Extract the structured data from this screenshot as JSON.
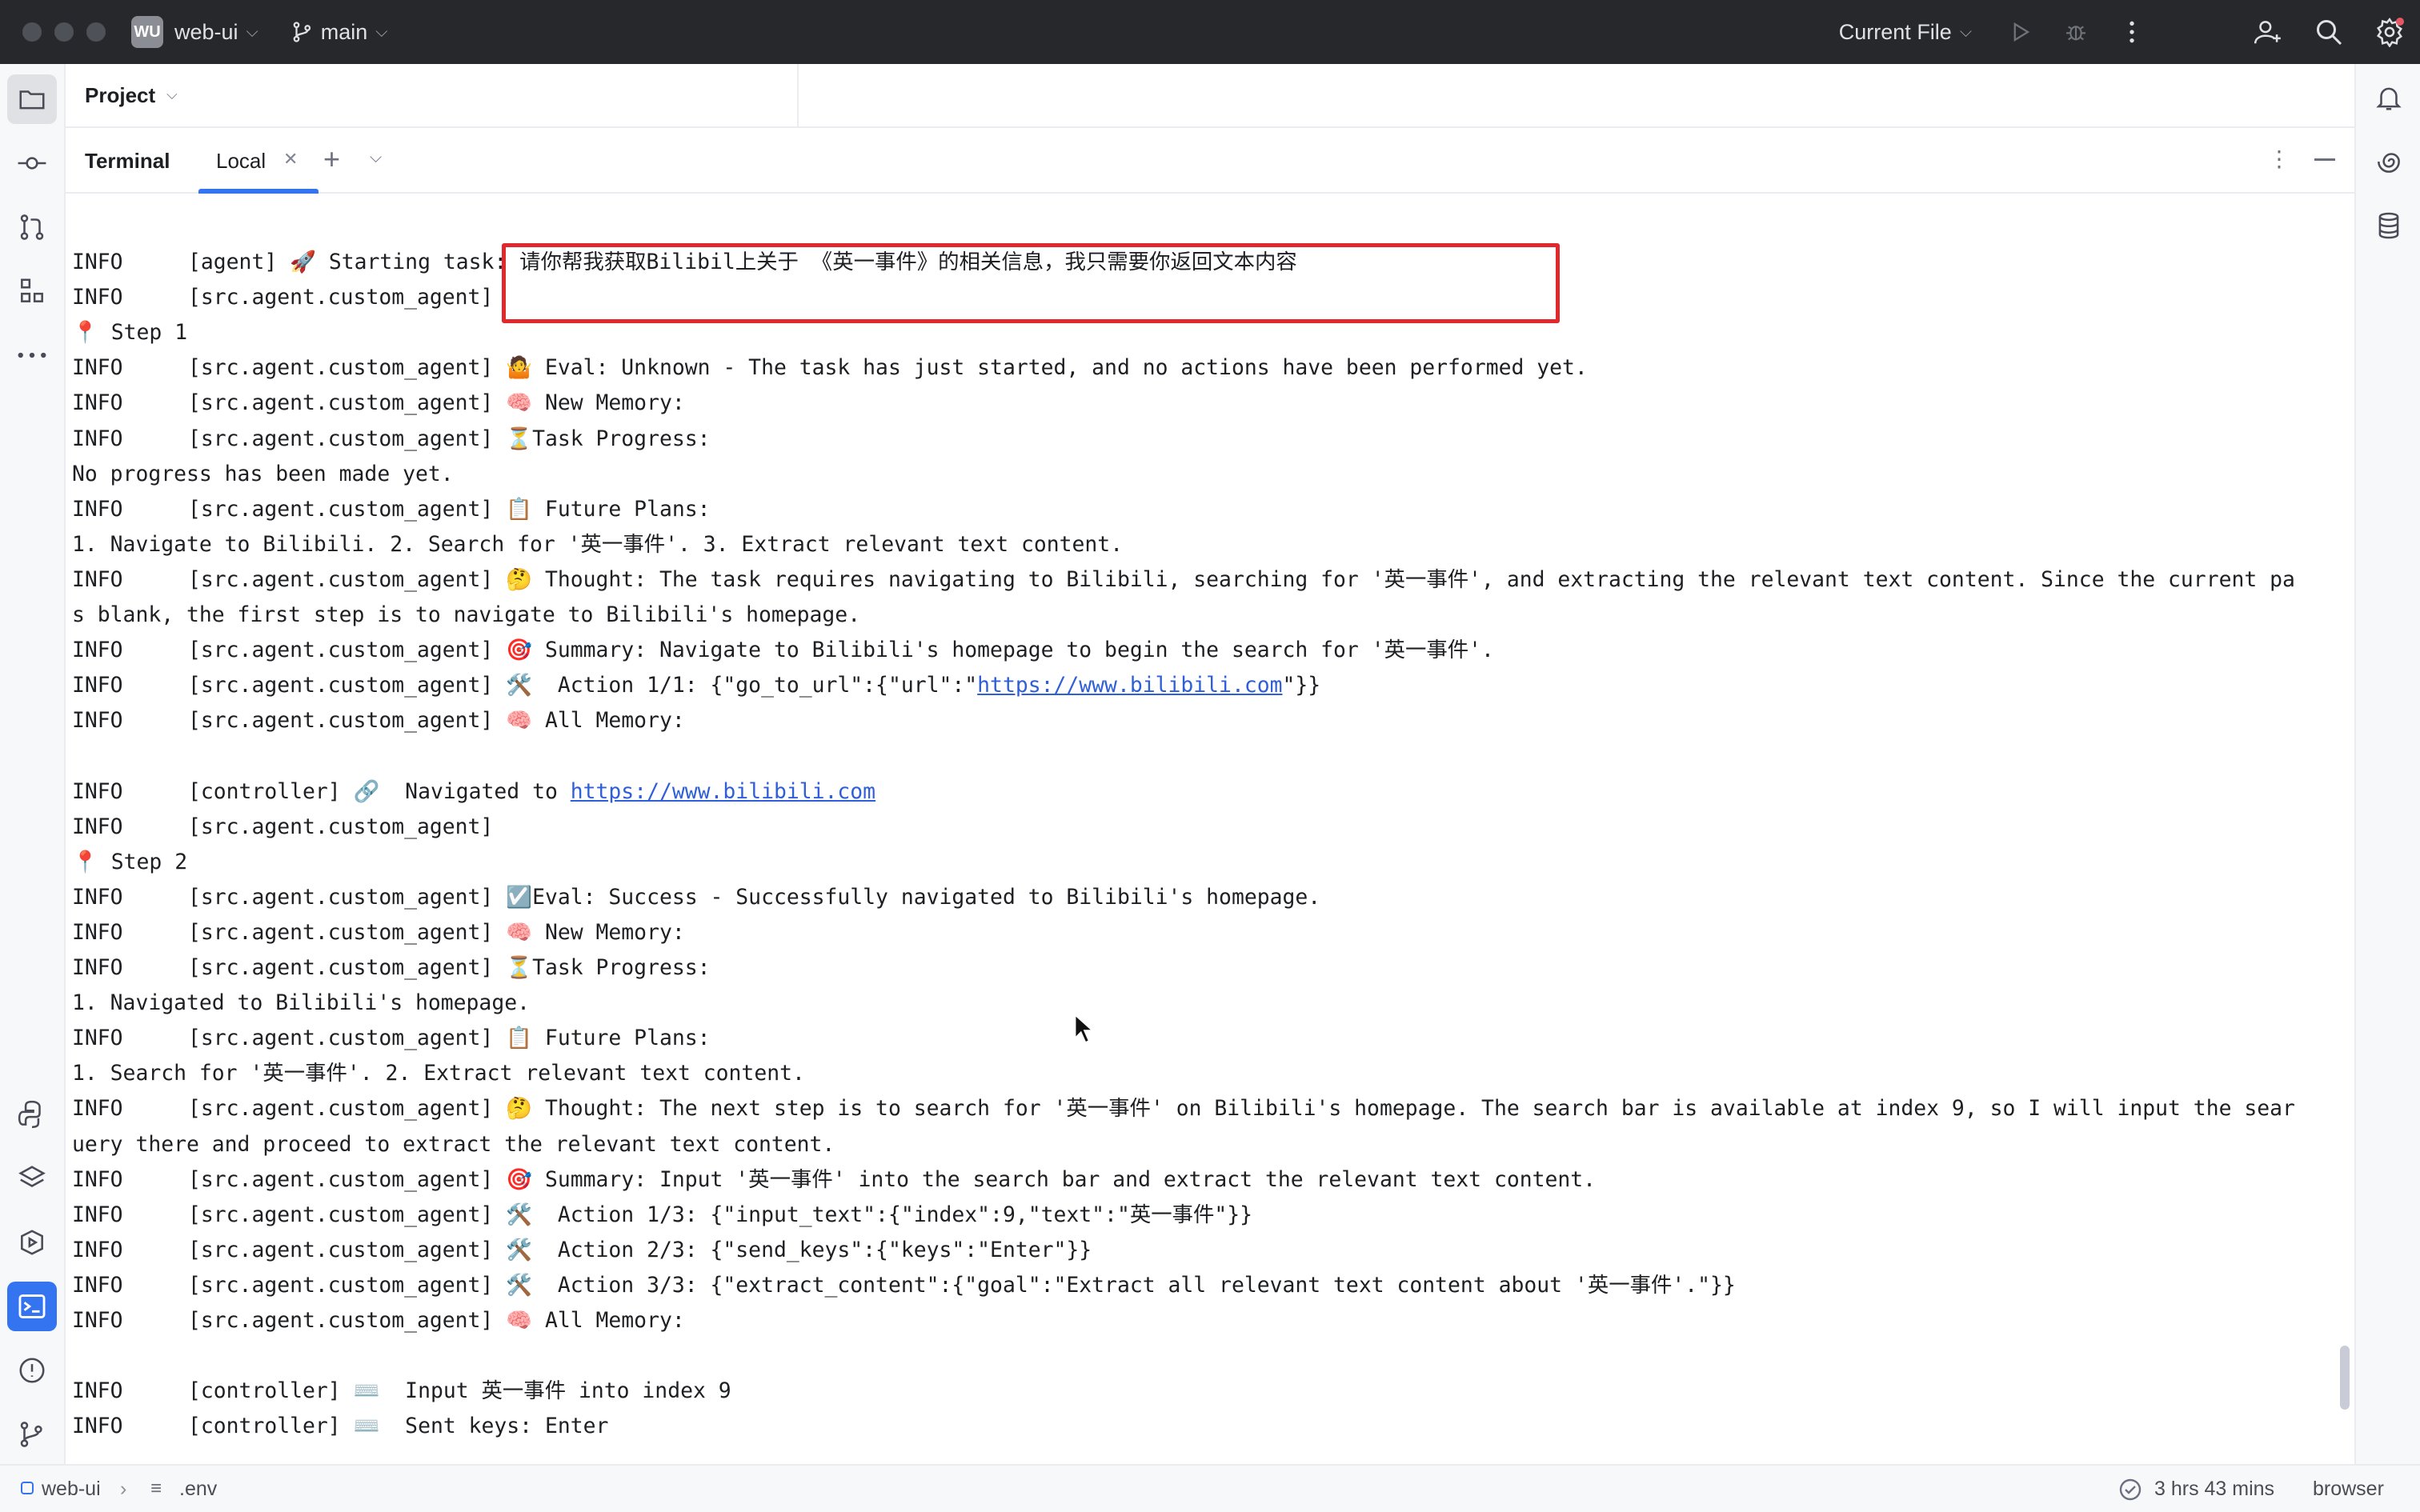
{
  "titlebar": {
    "project_badge": "WU",
    "project_name": "web-ui",
    "branch": "main",
    "run_config": "Current File",
    "icons": [
      "play-icon",
      "debug-icon",
      "more-icon",
      "add-user-icon",
      "search-icon",
      "settings-icon"
    ]
  },
  "project_panel": {
    "title": "Project"
  },
  "terminal": {
    "title": "Terminal",
    "tab_label": "Local",
    "lines": [
      {
        "prefix": "INFO",
        "text": "[agent] 🚀 Starting task: 请你帮我获取Bilibil上关于 《英一事件》的相关信息，我只需要你返回文本内容"
      },
      {
        "prefix": "INFO",
        "text": "[src.agent.custom_agent]"
      },
      {
        "prefix": "",
        "text": "📍 Step 1"
      },
      {
        "prefix": "INFO",
        "text": "[src.agent.custom_agent] 🤷 Eval: Unknown - The task has just started, and no actions have been performed yet."
      },
      {
        "prefix": "INFO",
        "text": "[src.agent.custom_agent] 🧠 New Memory:"
      },
      {
        "prefix": "INFO",
        "text": "[src.agent.custom_agent] ⏳Task Progress:"
      },
      {
        "prefix": "",
        "text": "No progress has been made yet."
      },
      {
        "prefix": "INFO",
        "text": "[src.agent.custom_agent] 📋 Future Plans:"
      },
      {
        "prefix": "",
        "text": "1. Navigate to Bilibili. 2. Search for '英一事件'. 3. Extract relevant text content."
      },
      {
        "prefix": "INFO",
        "text": "[src.agent.custom_agent] 🤔 Thought: The task requires navigating to Bilibili, searching for '英一事件', and extracting the relevant text content. Since the current pa"
      },
      {
        "prefix": "",
        "text": "s blank, the first step is to navigate to Bilibili's homepage."
      },
      {
        "prefix": "INFO",
        "text": "[src.agent.custom_agent] 🎯 Summary: Navigate to Bilibili's homepage to begin the search for '英一事件'."
      },
      {
        "prefix": "INFO",
        "text": "[src.agent.custom_agent] 🛠️  Action 1/1: {\"go_to_url\":{\"url\":\"",
        "link": "https://www.bilibili.com",
        "after": "\"}}"
      },
      {
        "prefix": "INFO",
        "text": "[src.agent.custom_agent] 🧠 All Memory:"
      },
      {
        "prefix": "",
        "text": ""
      },
      {
        "prefix": "INFO",
        "text": "[controller] 🔗  Navigated to ",
        "link": "https://www.bilibili.com",
        "after": ""
      },
      {
        "prefix": "INFO",
        "text": "[src.agent.custom_agent]"
      },
      {
        "prefix": "",
        "text": "📍 Step 2"
      },
      {
        "prefix": "INFO",
        "text": "[src.agent.custom_agent] ☑️Eval: Success - Successfully navigated to Bilibili's homepage."
      },
      {
        "prefix": "INFO",
        "text": "[src.agent.custom_agent] 🧠 New Memory:"
      },
      {
        "prefix": "INFO",
        "text": "[src.agent.custom_agent] ⏳Task Progress:"
      },
      {
        "prefix": "",
        "text": "1. Navigated to Bilibili's homepage."
      },
      {
        "prefix": "INFO",
        "text": "[src.agent.custom_agent] 📋 Future Plans:"
      },
      {
        "prefix": "",
        "text": "1. Search for '英一事件'. 2. Extract relevant text content."
      },
      {
        "prefix": "INFO",
        "text": "[src.agent.custom_agent] 🤔 Thought: The next step is to search for '英一事件' on Bilibili's homepage. The search bar is available at index 9, so I will input the sear"
      },
      {
        "prefix": "",
        "text": "uery there and proceed to extract the relevant text content."
      },
      {
        "prefix": "INFO",
        "text": "[src.agent.custom_agent] 🎯 Summary: Input '英一事件' into the search bar and extract the relevant text content."
      },
      {
        "prefix": "INFO",
        "text": "[src.agent.custom_agent] 🛠️  Action 1/3: {\"input_text\":{\"index\":9,\"text\":\"英一事件\"}}"
      },
      {
        "prefix": "INFO",
        "text": "[src.agent.custom_agent] 🛠️  Action 2/3: {\"send_keys\":{\"keys\":\"Enter\"}}"
      },
      {
        "prefix": "INFO",
        "text": "[src.agent.custom_agent] 🛠️  Action 3/3: {\"extract_content\":{\"goal\":\"Extract all relevant text content about '英一事件'.\"}}"
      },
      {
        "prefix": "INFO",
        "text": "[src.agent.custom_agent] 🧠 All Memory:"
      },
      {
        "prefix": "",
        "text": ""
      },
      {
        "prefix": "INFO",
        "text": "[controller] ⌨️  Input 英一事件 into index 9"
      },
      {
        "prefix": "INFO",
        "text": "[controller] ⌨️  Sent keys: Enter"
      }
    ]
  },
  "statusbar": {
    "project": "web-ui",
    "file": ".env",
    "timer": "3 hrs 43 mins",
    "context": "browser"
  },
  "colors": {
    "accent": "#3574f0",
    "highlight_border": "#e0282d",
    "link": "#2f5fd8",
    "titlebar_bg": "#27282c"
  }
}
